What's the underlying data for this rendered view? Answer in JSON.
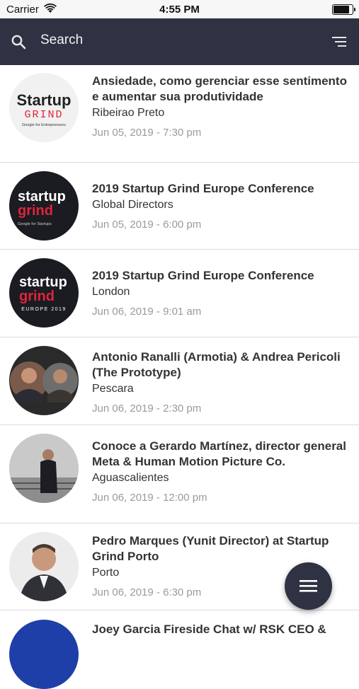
{
  "status_bar": {
    "carrier": "Carrier",
    "time": "4:55 PM"
  },
  "header": {
    "search_placeholder": "Search"
  },
  "events": [
    {
      "title": "Ansiedade, como gerenciar esse sentimento e aumentar sua produtividade",
      "location": "Ribeirao Preto",
      "date": "Jun 05, 2019 - 7:30 pm",
      "logo": {
        "line1": "Startup",
        "line2": "GRIND",
        "line3": "Google for Entrepreneurs"
      }
    },
    {
      "title": "2019 Startup Grind Europe Conference",
      "location": "Global Directors",
      "date": "Jun 05, 2019 - 6:00 pm",
      "logo": {
        "line1": "startup",
        "line2": "grind",
        "line3": "Google for Startups"
      }
    },
    {
      "title": "2019 Startup Grind Europe Conference",
      "location": "London",
      "date": "Jun 06, 2019 - 9:01 am",
      "logo": {
        "line1": "startup",
        "line2": "grind",
        "line3": "EUROPE 2019"
      }
    },
    {
      "title": "Antonio Ranalli (Armotia) & Andrea Pericoli (The Prototype)",
      "location": "Pescara",
      "date": "Jun 06, 2019 - 2:30 pm"
    },
    {
      "title": "Conoce a Gerardo Martínez, director general Meta & Human Motion Picture Co.",
      "location": "Aguascalientes",
      "date": "Jun 06, 2019 - 12:00 pm"
    },
    {
      "title": "Pedro Marques (Yunit Director) at Startup Grind Porto",
      "location": "Porto",
      "date": "Jun 06, 2019 - 6:30 pm"
    },
    {
      "title": "Joey Garcia Fireside Chat w/ RSK CEO &"
    }
  ],
  "colors": {
    "header_bg": "#2e3243",
    "grind_red": "#e0243c"
  }
}
